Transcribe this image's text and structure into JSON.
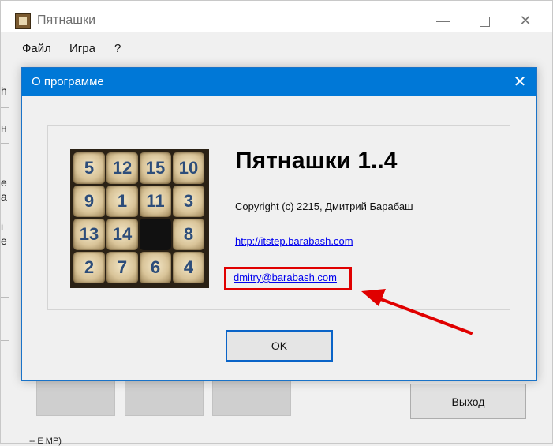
{
  "window": {
    "title": "Пятнашки",
    "minimize": "—",
    "close": "✕"
  },
  "menu": {
    "items": [
      "Файл",
      "Игра",
      "?"
    ]
  },
  "background": {
    "fragments": [
      "h",
      "н",
      "e",
      "a",
      "i",
      "e"
    ],
    "bottom_text": "-- E MP)",
    "exit_label": "Выход"
  },
  "dialog": {
    "title": "О программе",
    "close": "✕",
    "program_name": "Пятнашки 1..4",
    "copyright": "Copyright (c) 2215, Дмитрий Барабаш",
    "site": "http://itstep.barabash.com",
    "email": "dmitry@barabash.com",
    "ok_label": "OK",
    "board": [
      [
        "5",
        "12",
        "15",
        "10"
      ],
      [
        "9",
        "1",
        "11",
        "3"
      ],
      [
        "13",
        "14",
        "",
        "8"
      ],
      [
        "2",
        "7",
        "6",
        "4"
      ]
    ]
  },
  "colors": {
    "accent": "#0078d7",
    "highlight": "#e00000",
    "link": "#0000ee"
  }
}
